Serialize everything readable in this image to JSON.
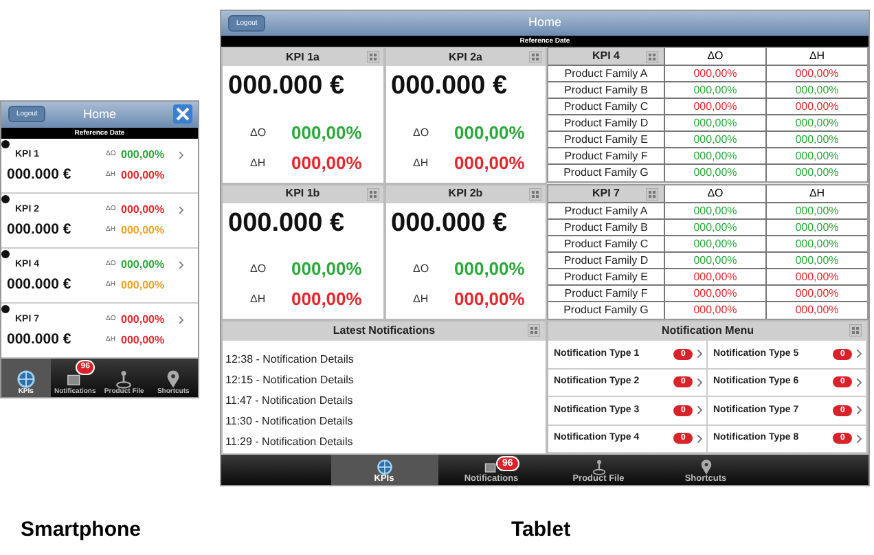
{
  "phone": {
    "logout": "Logout",
    "title": "Home",
    "subtitle": "Reference Date",
    "kpis": [
      {
        "name": "KPI 1",
        "value": "000.000 €",
        "rows": [
          {
            "label": "ΔO",
            "value": "000,00%",
            "color": "#2aa83a"
          },
          {
            "label": "ΔH",
            "value": "000,00%",
            "color": "#e0282e"
          }
        ]
      },
      {
        "name": "KPI 2",
        "value": "000.000 €",
        "rows": [
          {
            "label": "ΔO",
            "value": "000,00%",
            "color": "#e0282e"
          },
          {
            "label": "ΔH",
            "value": "000,00%",
            "color": "#f0a020"
          }
        ]
      },
      {
        "name": "KPI 4",
        "value": "000.000 €",
        "rows": [
          {
            "label": "ΔO",
            "value": "000,00%",
            "color": "#2aa83a"
          },
          {
            "label": "ΔH",
            "value": "000,00%",
            "color": "#f0a020"
          }
        ]
      },
      {
        "name": "KPI 7",
        "value": "000.000 €",
        "rows": [
          {
            "label": "ΔO",
            "value": "000,00%",
            "color": "#e0282e"
          },
          {
            "label": "ΔH",
            "value": "000,00%",
            "color": "#e0282e"
          }
        ]
      }
    ],
    "tabs": [
      {
        "label": "KPIs",
        "selected": true
      },
      {
        "label": "Notifications",
        "selected": false,
        "badge": "96"
      },
      {
        "label": "Product File",
        "selected": false
      },
      {
        "label": "Shortcuts",
        "selected": false
      }
    ]
  },
  "tablet": {
    "logout": "Logout",
    "title": "Home",
    "subtitle": "Reference Date",
    "cards": [
      {
        "name": "KPI 1a",
        "value": "000.000 €",
        "rows": [
          {
            "label": "ΔO",
            "value": "000,00%",
            "color": "#2aa83a"
          },
          {
            "label": "ΔH",
            "value": "000,00%",
            "color": "#e0282e"
          }
        ]
      },
      {
        "name": "KPI 2a",
        "value": "000.000 €",
        "rows": [
          {
            "label": "ΔO",
            "value": "000,00%",
            "color": "#2aa83a"
          },
          {
            "label": "ΔH",
            "value": "000,00%",
            "color": "#e0282e"
          }
        ]
      },
      {
        "name": "KPI 1b",
        "value": "000.000 €",
        "rows": [
          {
            "label": "ΔO",
            "value": "000,00%",
            "color": "#2aa83a"
          },
          {
            "label": "ΔH",
            "value": "000,00%",
            "color": "#e0282e"
          }
        ]
      },
      {
        "name": "KPI 2b",
        "value": "000.000 €",
        "rows": [
          {
            "label": "ΔO",
            "value": "000,00%",
            "color": "#2aa83a"
          },
          {
            "label": "ΔH",
            "value": "000,00%",
            "color": "#e0282e"
          }
        ]
      }
    ],
    "tables": [
      {
        "name": "KPI 4",
        "columns": [
          "ΔO",
          "ΔH"
        ],
        "rows": [
          {
            "label": "Product Family A",
            "cells": [
              {
                "text": "000,00%",
                "color": "#e0282e"
              },
              {
                "text": "000,00%",
                "color": "#e0282e"
              }
            ]
          },
          {
            "label": "Product Family B",
            "cells": [
              {
                "text": "000,00%",
                "color": "#2aa83a"
              },
              {
                "text": "000,00%",
                "color": "#2aa83a"
              }
            ]
          },
          {
            "label": "Product Family C",
            "cells": [
              {
                "text": "000,00%",
                "color": "#e0282e"
              },
              {
                "text": "000,00%",
                "color": "#e0282e"
              }
            ]
          },
          {
            "label": "Product Family D",
            "cells": [
              {
                "text": "000,00%",
                "color": "#2aa83a"
              },
              {
                "text": "000,00%",
                "color": "#2aa83a"
              }
            ]
          },
          {
            "label": "Product Family E",
            "cells": [
              {
                "text": "000,00%",
                "color": "#2aa83a"
              },
              {
                "text": "000,00%",
                "color": "#2aa83a"
              }
            ]
          },
          {
            "label": "Product Family F",
            "cells": [
              {
                "text": "000,00%",
                "color": "#2aa83a"
              },
              {
                "text": "000,00%",
                "color": "#2aa83a"
              }
            ]
          },
          {
            "label": "Product Family G",
            "cells": [
              {
                "text": "000,00%",
                "color": "#2aa83a"
              },
              {
                "text": "000,00%",
                "color": "#2aa83a"
              }
            ]
          }
        ]
      },
      {
        "name": "KPI 7",
        "columns": [
          "ΔO",
          "ΔH"
        ],
        "rows": [
          {
            "label": "Product Family A",
            "cells": [
              {
                "text": "000,00%",
                "color": "#2aa83a"
              },
              {
                "text": "000,00%",
                "color": "#2aa83a"
              }
            ]
          },
          {
            "label": "Product Family B",
            "cells": [
              {
                "text": "000,00%",
                "color": "#2aa83a"
              },
              {
                "text": "000,00%",
                "color": "#2aa83a"
              }
            ]
          },
          {
            "label": "Product Family C",
            "cells": [
              {
                "text": "000,00%",
                "color": "#2aa83a"
              },
              {
                "text": "000,00%",
                "color": "#2aa83a"
              }
            ]
          },
          {
            "label": "Product Family D",
            "cells": [
              {
                "text": "000,00%",
                "color": "#2aa83a"
              },
              {
                "text": "000,00%",
                "color": "#2aa83a"
              }
            ]
          },
          {
            "label": "Product Family E",
            "cells": [
              {
                "text": "000,00%",
                "color": "#e0282e"
              },
              {
                "text": "000,00%",
                "color": "#e0282e"
              }
            ]
          },
          {
            "label": "Product Family F",
            "cells": [
              {
                "text": "000,00%",
                "color": "#e0282e"
              },
              {
                "text": "000,00%",
                "color": "#e0282e"
              }
            ]
          },
          {
            "label": "Product Family G",
            "cells": [
              {
                "text": "000,00%",
                "color": "#e0282e"
              },
              {
                "text": "000,00%",
                "color": "#e0282e"
              }
            ]
          }
        ]
      }
    ],
    "notifications": {
      "title": "Latest Notifications",
      "items": [
        "12:38 - Notification Details",
        "12:15 - Notification Details",
        "11:47 - Notification Details",
        "11:30 - Notification Details",
        "11:29 - Notification Details"
      ]
    },
    "notification_menu": {
      "title": "Notification Menu",
      "items": [
        {
          "label": "Notification Type 1",
          "count": "0"
        },
        {
          "label": "Notification Type 5",
          "count": "0"
        },
        {
          "label": "Notification Type 2",
          "count": "0"
        },
        {
          "label": "Notification Type 6",
          "count": "0"
        },
        {
          "label": "Notification Type 3",
          "count": "0"
        },
        {
          "label": "Notification Type 7",
          "count": "0"
        },
        {
          "label": "Notification Type 4",
          "count": "0"
        },
        {
          "label": "Notification Type 8",
          "count": "0"
        }
      ]
    },
    "tabs": [
      {
        "label": "KPIs",
        "selected": true
      },
      {
        "label": "Notifications",
        "selected": false,
        "badge": "96"
      },
      {
        "label": "Product File",
        "selected": false
      },
      {
        "label": "Shortcuts",
        "selected": false
      }
    ]
  },
  "captions": [
    "Smartphone",
    "Tablet"
  ]
}
